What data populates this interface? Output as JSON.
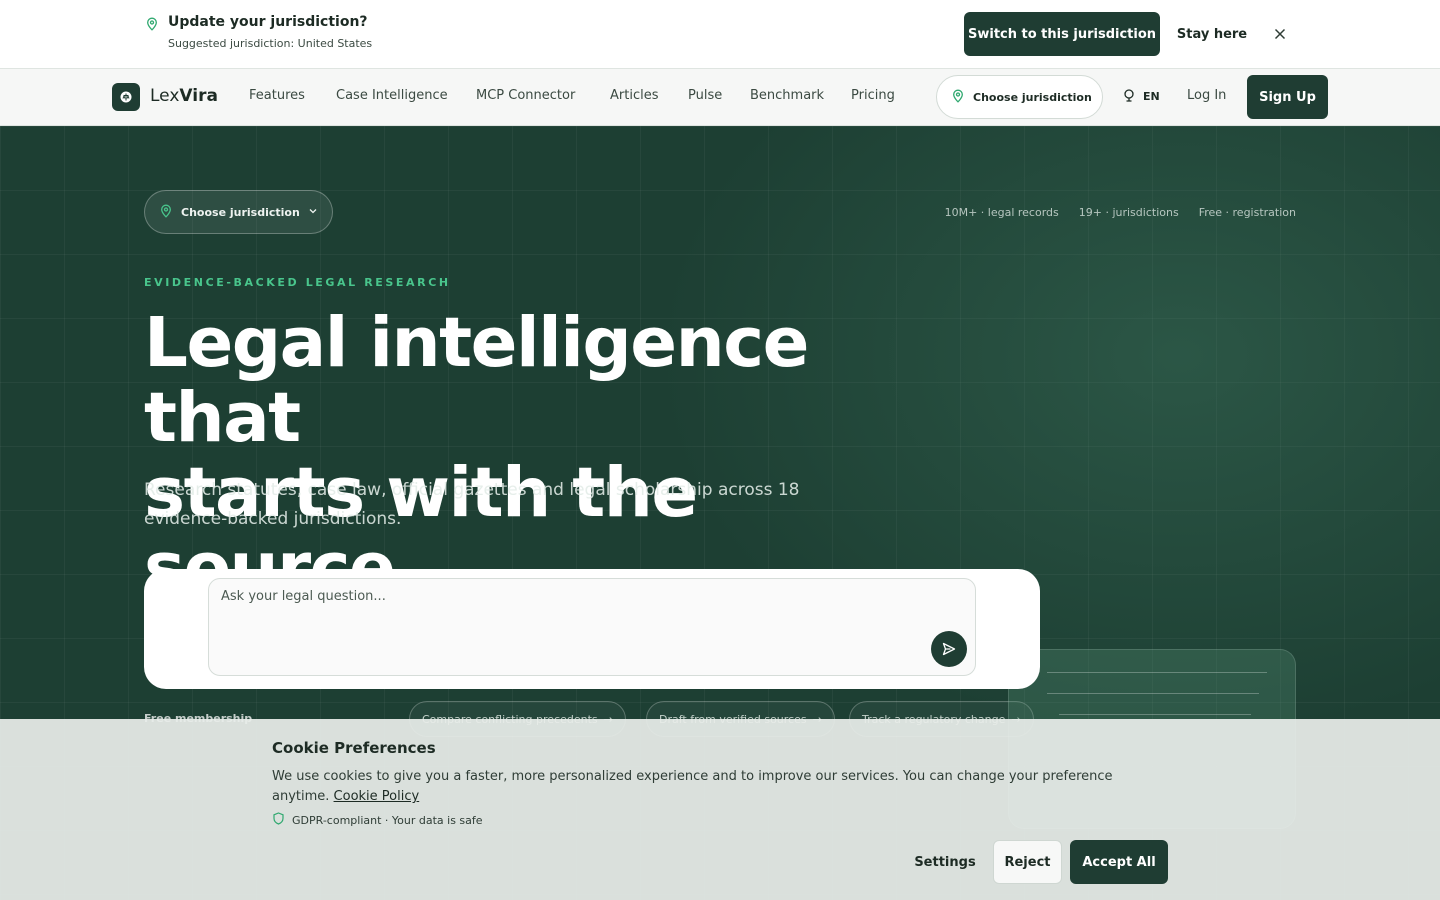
{
  "banner": {
    "title": "Update your jurisdiction?",
    "subtitle": "Suggested jurisdiction: United States",
    "switch_label": "Switch to this jurisdiction",
    "stay_label": "Stay here",
    "icon": "map-pin-icon"
  },
  "nav": {
    "logo_prefix": "Lex",
    "logo_suffix": "Vira",
    "links": [
      "Features",
      "Case Intelligence",
      "MCP Connector",
      "Articles",
      "Pulse",
      "Benchmark",
      "Pricing"
    ],
    "jurisdiction_label": "Choose jurisdiction",
    "language": "EN",
    "login_label": "Log In",
    "signup_label": "Sign Up"
  },
  "hero": {
    "jurisdiction_label": "Choose jurisdiction",
    "stats": [
      "10M+ · legal records",
      "19+ · jurisdictions",
      "Free · registration"
    ],
    "eyebrow": "EVIDENCE-BACKED LEGAL RESEARCH",
    "headline_line1": "Legal intelligence that",
    "headline_line2": "starts with the source.",
    "lead": "Research statutes, case law, official gazettes and legal scholarship across 18 evidence-backed jurisdictions.",
    "ask_placeholder": "Ask your legal question...",
    "free_membership": "Free membership",
    "chips": [
      "Compare conflicting precedents",
      "Draft from verified sources",
      "Track a regulatory change"
    ]
  },
  "cookie": {
    "title": "Cookie Preferences",
    "text": "We use cookies to give you a faster, more personalized experience and to improve our services. You can change your preference anytime.",
    "policy_link": "Cookie Policy",
    "gdpr": "GDPR-compliant · Your data is safe",
    "settings_label": "Settings",
    "reject_label": "Reject",
    "accept_label": "Accept All"
  },
  "colors": {
    "brand_dark": "#1f3d33",
    "hero_bg": "#1d3f33",
    "accent_green": "#49c58c"
  }
}
